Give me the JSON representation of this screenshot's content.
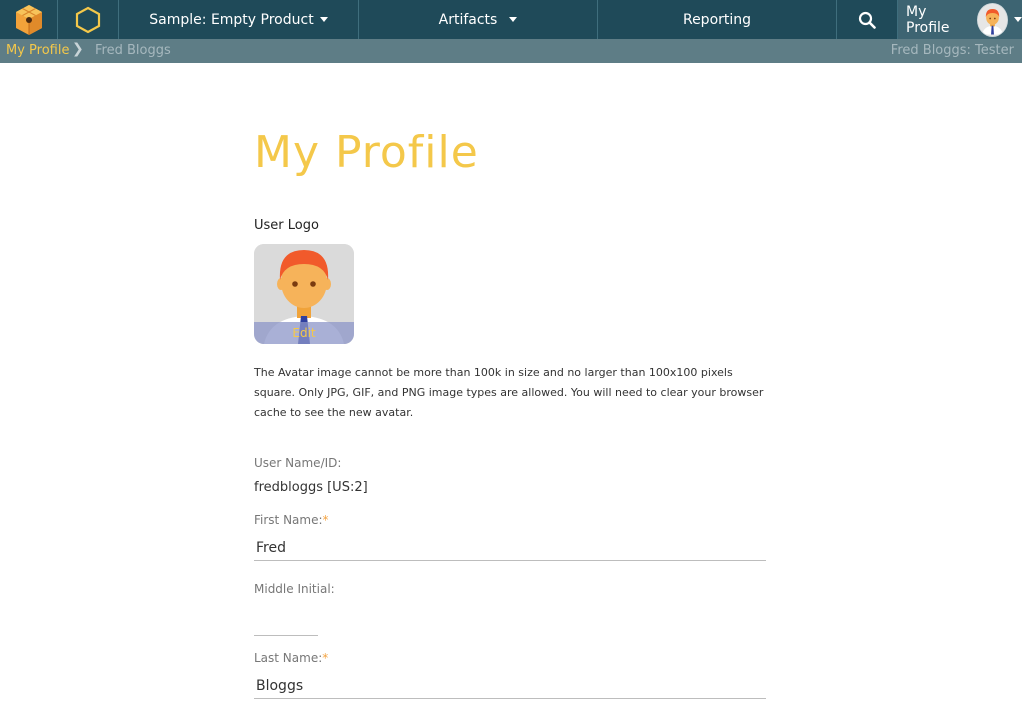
{
  "topbar": {
    "product_label": "Sample: Empty Product",
    "artifacts_label": "Artifacts",
    "reporting_label": "Reporting",
    "profile_label": "My Profile"
  },
  "breadcrumb": {
    "home": "My Profile",
    "current": "Fred Bloggs",
    "user_role": "Fred Bloggs: Tester"
  },
  "page": {
    "title": "My Profile",
    "user_logo_label": "User Logo",
    "avatar_edit_label": "Edit",
    "avatar_note": "The Avatar image cannot be more than 100k in size and no larger than 100x100 pixels square. Only JPG, GIF, and PNG image types are allowed. You will need to clear your browser cache to see the new avatar."
  },
  "fields": {
    "username_label": "User Name/ID:",
    "username_value": "fredbloggs [US:2]",
    "first_name_label": "First Name:",
    "first_name_value": "Fred",
    "middle_initial_label": "Middle Initial:",
    "middle_initial_value": "",
    "last_name_label": "Last Name:",
    "last_name_value": "Bloggs",
    "required_marker": "*"
  },
  "colors": {
    "nav_bg": "#1f4a59",
    "breadcrumb_bg": "#5e7d86",
    "accent": "#f4c84a"
  },
  "icons": [
    "app-logo-icon",
    "hexagon-icon",
    "search-icon",
    "chevron-right-icon",
    "caret-down-icon"
  ]
}
